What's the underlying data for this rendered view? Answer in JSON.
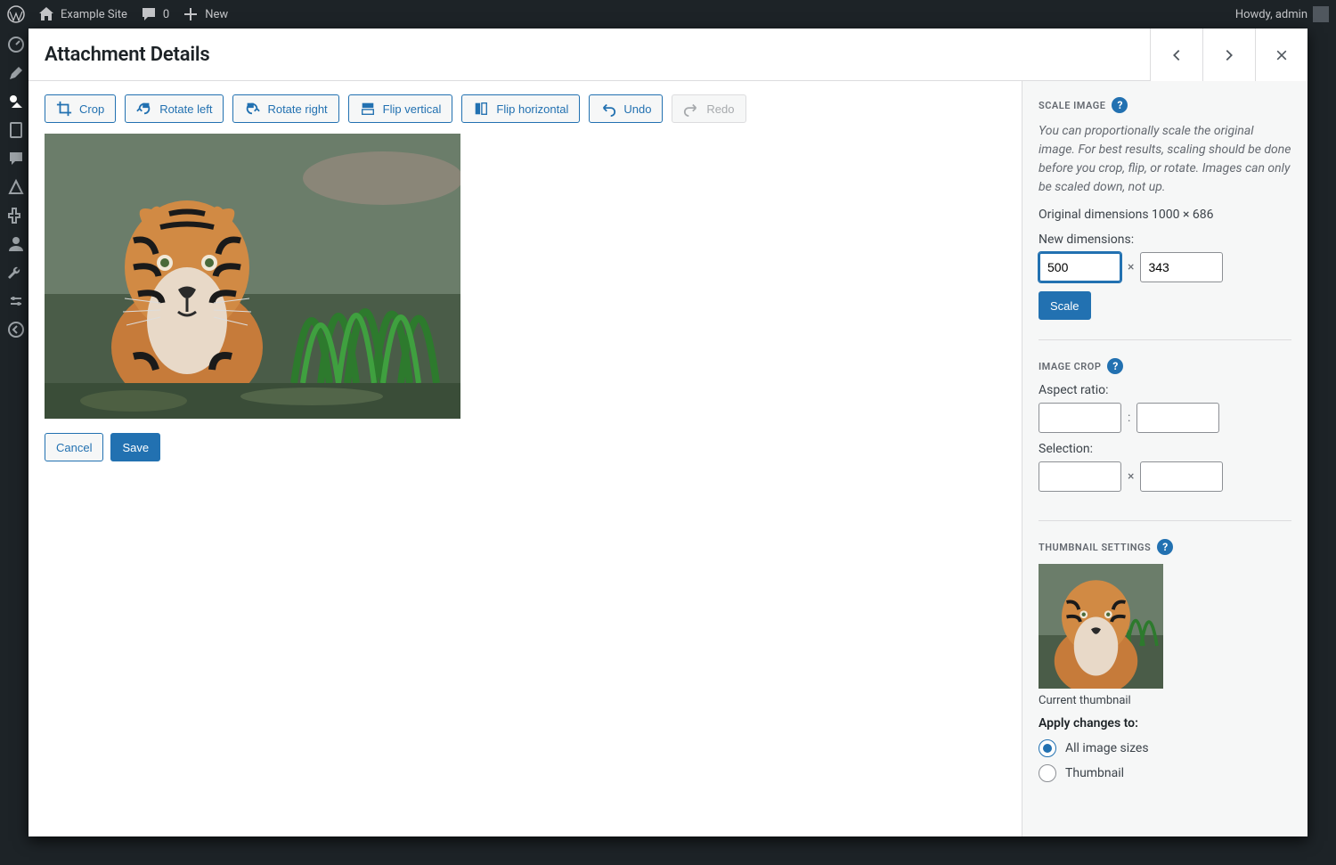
{
  "adminbar": {
    "site_name": "Example Site",
    "comments_count": "0",
    "new_label": "New",
    "howdy": "Howdy, admin"
  },
  "modal": {
    "title": "Attachment Details"
  },
  "toolbar": {
    "crop": "Crop",
    "rotate_left": "Rotate left",
    "rotate_right": "Rotate right",
    "flip_vertical": "Flip vertical",
    "flip_horizontal": "Flip horizontal",
    "undo": "Undo",
    "redo": "Redo"
  },
  "actions": {
    "cancel": "Cancel",
    "save": "Save"
  },
  "scale": {
    "title": "SCALE IMAGE",
    "help": "You can proportionally scale the original image. For best results, scaling should be done before you crop, flip, or rotate. Images can only be scaled down, not up.",
    "original": "Original dimensions 1000 × 686",
    "new_label": "New dimensions:",
    "width": "500",
    "height": "343",
    "sep": "×",
    "button": "Scale"
  },
  "crop": {
    "title": "IMAGE CROP",
    "aspect_label": "Aspect ratio:",
    "aspect_w": "",
    "aspect_h": "",
    "aspect_sep": ":",
    "selection_label": "Selection:",
    "sel_w": "",
    "sel_h": "",
    "sel_sep": "×"
  },
  "thumb": {
    "title": "THUMBNAIL SETTINGS",
    "caption": "Current thumbnail",
    "apply_label": "Apply changes to:",
    "opt_all": "All image sizes",
    "opt_thumb": "Thumbnail"
  }
}
